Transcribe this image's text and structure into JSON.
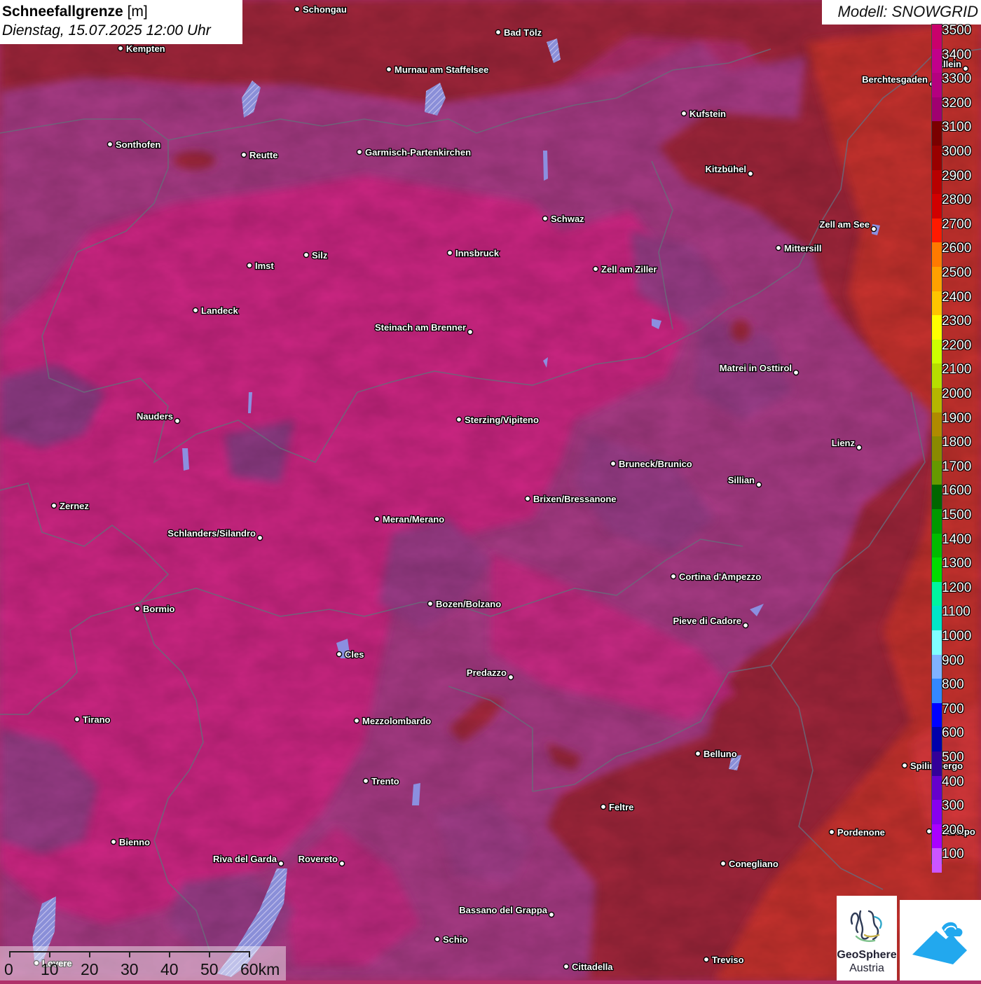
{
  "header": {
    "title_bold": "Schneefallgrenze",
    "title_unit": "[m]",
    "datetime": "Dienstag, 15.07.2025 12:00 Uhr",
    "model": "Modell: SNOWGRID"
  },
  "legend": {
    "labels": [
      "3500",
      "3400",
      "3300",
      "3200",
      "3100",
      "3000",
      "2900",
      "2800",
      "2700",
      "2600",
      "2500",
      "2400",
      "2300",
      "2200",
      "2100",
      "2000",
      "1900",
      "1800",
      "1700",
      "1600",
      "1500",
      "1400",
      "1300",
      "1200",
      "1100",
      "1000",
      "900",
      "800",
      "700",
      "600",
      "500",
      "400",
      "300",
      "200",
      "100"
    ],
    "colors": [
      "#c9006b",
      "#c2008a",
      "#b5007f",
      "#a00070",
      "#7a0000",
      "#990000",
      "#b80000",
      "#d10000",
      "#ff1a00",
      "#ff7a00",
      "#ffa000",
      "#ffc400",
      "#ffff00",
      "#ccff00",
      "#b7dd00",
      "#b5b500",
      "#b08a00",
      "#8a8a00",
      "#669900",
      "#006600",
      "#009900",
      "#00bb00",
      "#00dd00",
      "#00f5a0",
      "#00e6c8",
      "#80ffff",
      "#80b3ff",
      "#3388ff",
      "#0000ff",
      "#0000aa",
      "#330099",
      "#6600cc",
      "#8800ee",
      "#aa00ff",
      "#cc55ff"
    ]
  },
  "scale": {
    "labels": [
      "0",
      "10",
      "20",
      "30",
      "40",
      "50",
      "60km"
    ]
  },
  "logos": {
    "geosphere_line1": "GeoSphere",
    "geosphere_line2": "Austria"
  },
  "cities": [
    {
      "name": "Schongau",
      "anchor": "start"
    },
    {
      "name": "Kempten",
      "anchor": "start"
    },
    {
      "name": "Bad Tölz",
      "anchor": "start"
    },
    {
      "name": "Murnau am Staffelsee",
      "anchor": "start"
    },
    {
      "name": "Berchtesgaden",
      "anchor": "end"
    },
    {
      "name": "Hallein",
      "anchor": "end"
    },
    {
      "name": "Kufstein",
      "anchor": "start"
    },
    {
      "name": "Sonthofen",
      "anchor": "start"
    },
    {
      "name": "Reutte",
      "anchor": "start"
    },
    {
      "name": "Garmisch-Partenkirchen",
      "anchor": "start"
    },
    {
      "name": "Kitzbühel",
      "anchor": "end"
    },
    {
      "name": "Schwaz",
      "anchor": "start"
    },
    {
      "name": "Zell am See",
      "anchor": "end"
    },
    {
      "name": "Mittersill",
      "anchor": "start"
    },
    {
      "name": "Innsbruck",
      "anchor": "start"
    },
    {
      "name": "Silz",
      "anchor": "start"
    },
    {
      "name": "Imst",
      "anchor": "start"
    },
    {
      "name": "Zell am Ziller",
      "anchor": "start"
    },
    {
      "name": "Landeck",
      "anchor": "start"
    },
    {
      "name": "Steinach am Brenner",
      "anchor": "end"
    },
    {
      "name": "Matrei in Osttirol",
      "anchor": "end"
    },
    {
      "name": "Nauders",
      "anchor": "end"
    },
    {
      "name": "Sterzing/Vipiteno",
      "anchor": "start"
    },
    {
      "name": "Lienz",
      "anchor": "end"
    },
    {
      "name": "Bruneck/Brunico",
      "anchor": "start"
    },
    {
      "name": "Sillian",
      "anchor": "end"
    },
    {
      "name": "Zernez",
      "anchor": "start"
    },
    {
      "name": "Brixen/Bressanone",
      "anchor": "start"
    },
    {
      "name": "Meran/Merano",
      "anchor": "start"
    },
    {
      "name": "Schlanders/Silandro",
      "anchor": "end"
    },
    {
      "name": "Cortina d'Ampezzo",
      "anchor": "start"
    },
    {
      "name": "Bozen/Bolzano",
      "anchor": "start"
    },
    {
      "name": "Bormio",
      "anchor": "start"
    },
    {
      "name": "Pieve di Cadore",
      "anchor": "end"
    },
    {
      "name": "Cles",
      "anchor": "start"
    },
    {
      "name": "Predazzo",
      "anchor": "end"
    },
    {
      "name": "Tirano",
      "anchor": "start"
    },
    {
      "name": "Mezzolombardo",
      "anchor": "start"
    },
    {
      "name": "Belluno",
      "anchor": "start"
    },
    {
      "name": "Spilimbergo",
      "anchor": "start"
    },
    {
      "name": "Trento",
      "anchor": "start"
    },
    {
      "name": "Feltre",
      "anchor": "start"
    },
    {
      "name": "Pordenone",
      "anchor": "start"
    },
    {
      "name": "Codroipo",
      "anchor": "start"
    },
    {
      "name": "Bienno",
      "anchor": "start"
    },
    {
      "name": "Riva del Garda",
      "anchor": "end"
    },
    {
      "name": "Rovereto",
      "anchor": "end"
    },
    {
      "name": "Conegliano",
      "anchor": "start"
    },
    {
      "name": "Bassano del Grappa",
      "anchor": "end"
    },
    {
      "name": "Schio",
      "anchor": "start"
    },
    {
      "name": "Treviso",
      "anchor": "start"
    },
    {
      "name": "Cittadella",
      "anchor": "start"
    },
    {
      "name": "Lovere",
      "anchor": "start"
    }
  ]
}
